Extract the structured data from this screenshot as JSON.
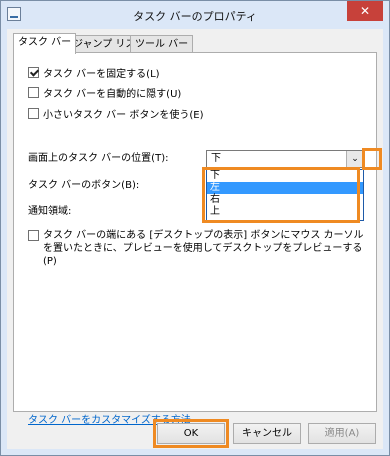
{
  "window": {
    "title": "タスク バーのプロパティ",
    "close_glyph": "✕"
  },
  "tabs": [
    {
      "label": "タスク バー"
    },
    {
      "label": "ジャンプ リスト"
    },
    {
      "label": "ツール バー"
    }
  ],
  "options": {
    "lock": {
      "label": "タスク バーを固定する(L)",
      "checked": true
    },
    "autohide": {
      "label": "タスク バーを自動的に隠す(U)",
      "checked": false
    },
    "small_buttons": {
      "label": "小さいタスク バー ボタンを使う(E)",
      "checked": false
    }
  },
  "position": {
    "label": "画面上のタスク バーの位置(T):",
    "selected": "下",
    "dropdown_glyph": "⌄",
    "choices": [
      "下",
      "左",
      "右",
      "上"
    ],
    "highlighted_index": 1
  },
  "buttons_label": "タスク バーのボタン(B):",
  "notification_label": "通知領域:",
  "peek": {
    "label": "タスク バーの端にある [デスクトップの表示] ボタンにマウス カーソルを置いたときに、プレビューを使用してデスクトップをプレビューする(P)",
    "checked": false
  },
  "customize_link": "タスク バーをカスタマイズする方法",
  "footer": {
    "ok": "OK",
    "cancel": "キャンセル",
    "apply": "適用(A)"
  },
  "colors": {
    "highlight": "#ef8a22",
    "selection": "#3399ff",
    "link": "#0066cc"
  }
}
